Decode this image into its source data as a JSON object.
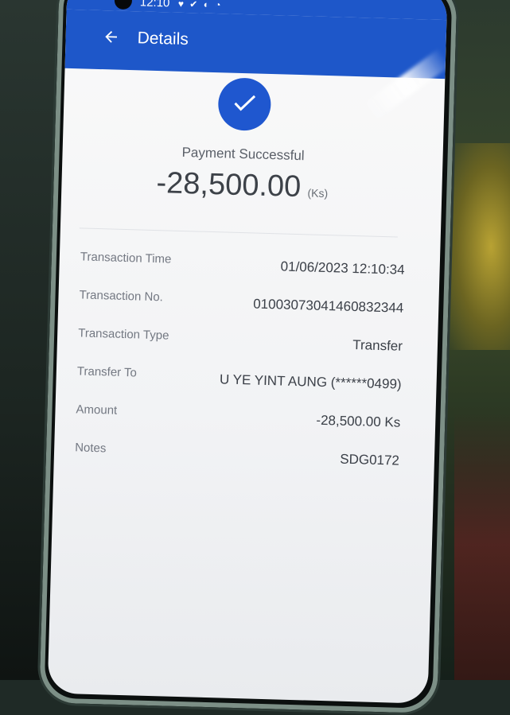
{
  "statusbar": {
    "time": "12:10",
    "icons": "♥ ✔ ◐ ◔"
  },
  "appbar": {
    "title": "Details"
  },
  "result": {
    "status_text": "Payment Successful",
    "amount": "-28,500.00",
    "unit": "(Ks)"
  },
  "details": [
    {
      "label": "Transaction Time",
      "value": "01/06/2023 12:10:34"
    },
    {
      "label": "Transaction No.",
      "value": "01003073041460832344"
    },
    {
      "label": "Transaction Type",
      "value": "Transfer"
    },
    {
      "label": "Transfer To",
      "value": "U YE YINT AUNG (******0499)"
    },
    {
      "label": "Amount",
      "value": "-28,500.00 Ks"
    },
    {
      "label": "Notes",
      "value": "SDG0172"
    }
  ],
  "colors": {
    "primary": "#1e57c9",
    "success_circle": "#1f57cf"
  },
  "icons": {
    "back": "arrow-left-icon",
    "success": "checkmark-icon"
  }
}
